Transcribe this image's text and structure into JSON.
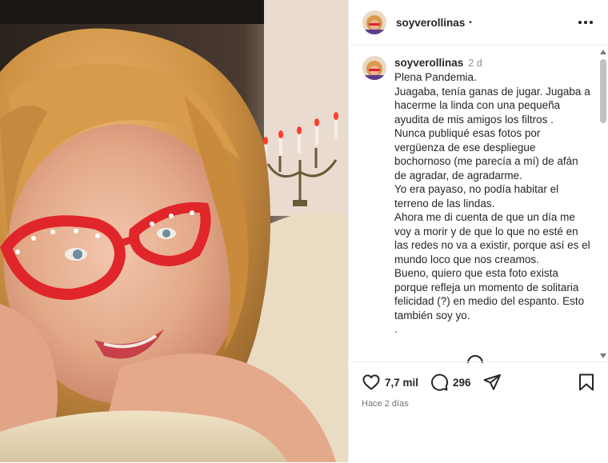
{
  "header": {
    "username": "soyverollinas",
    "dot": "•",
    "more_icon": "more-horizontal-icon"
  },
  "caption": {
    "username": "soyverollinas",
    "time": "2 d",
    "lines": [
      "Plena Pandemia.",
      "Juagaba, tenía ganas de jugar. Jugaba a",
      "hacerme la linda con una pequeña",
      "ayudita de mis amigos los filtros .",
      "Nunca publiqué esas fotos por",
      "vergüenza de ese despliegue",
      "bochornoso (me parecía a mí) de afán",
      "de agradar, de agradarme.",
      "Yo era payaso, no podía habitar el",
      "terreno de las lindas.",
      "Ahora me di cuenta de que un día me",
      "voy a morir y de que lo que no esté en",
      "las redes no va a existir, porque así es el",
      "mundo loco que nos creamos.",
      "Bueno, quiero que esta foto exista",
      "porque refleja un momento de solitaria",
      "felicidad (?) en medio del espanto. Esto",
      "también soy yo.",
      "."
    ]
  },
  "actions": {
    "likes": "7,7 mil",
    "comments": "296",
    "time_ago": "Hace 2 días",
    "icons": [
      "heart-icon",
      "comment-icon",
      "share-icon",
      "bookmark-icon"
    ]
  },
  "colors": {
    "text": "#262626",
    "muted": "#8e8e8e",
    "divider": "#efefef",
    "glasses": "#e0262b"
  }
}
